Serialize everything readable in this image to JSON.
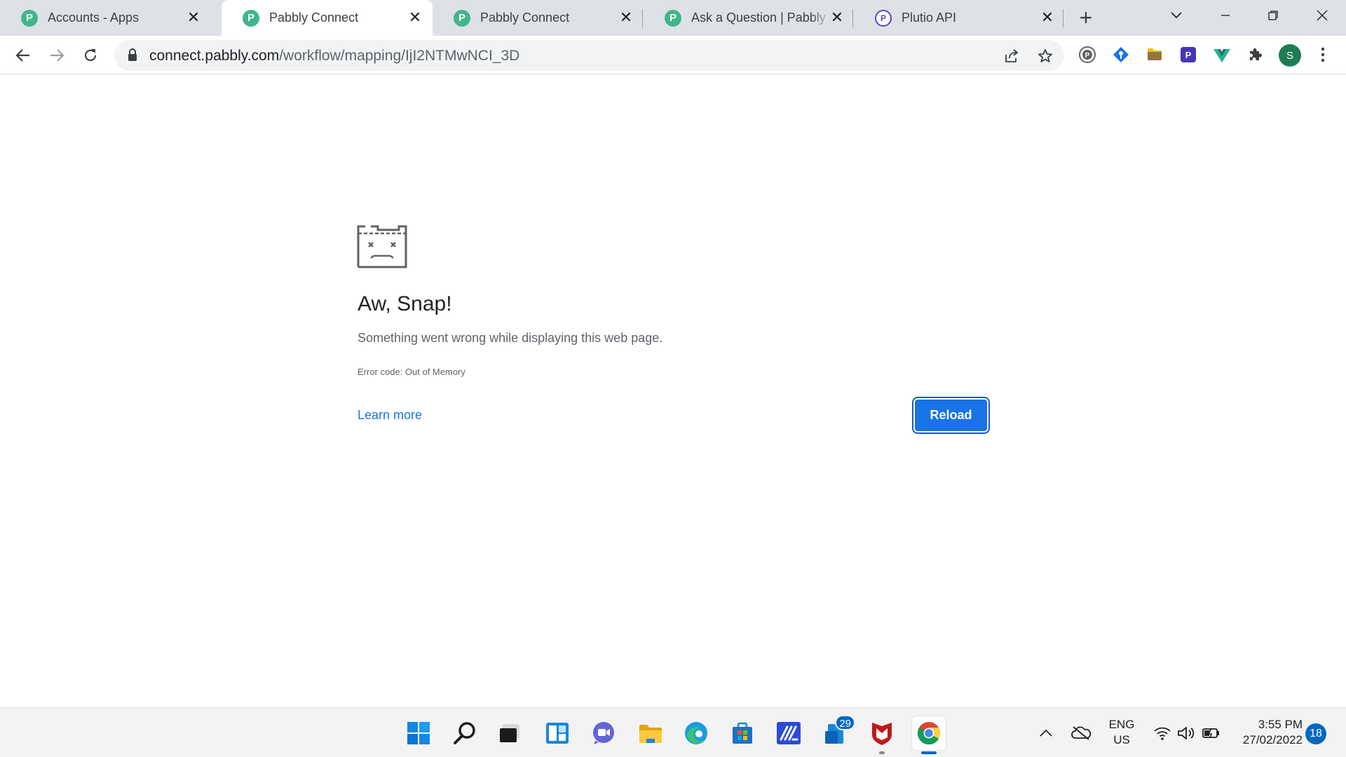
{
  "tabs": [
    {
      "title": "Accounts - Apps",
      "favicon": "pabbly-icon",
      "active": false
    },
    {
      "title": "Pabbly Connect",
      "favicon": "pabbly-icon",
      "active": true
    },
    {
      "title": "Pabbly Connect",
      "favicon": "pabbly-icon",
      "active": false
    },
    {
      "title": "Ask a Question | Pabbly S",
      "favicon": "pabbly-icon",
      "active": false
    },
    {
      "title": "Plutio API",
      "favicon": "plutio-icon",
      "active": false
    }
  ],
  "address_bar": {
    "host": "connect.pabbly.com",
    "path": "/workflow/mapping/IjI2NTMwNCI_3D"
  },
  "profile": {
    "initial": "S"
  },
  "error_page": {
    "title": "Aw, Snap!",
    "description": "Something went wrong while displaying this web page.",
    "error_code": "Error code: Out of Memory",
    "learn_more": "Learn more",
    "reload": "Reload"
  },
  "taskbar": {
    "mail_badge": "29",
    "language_line1": "ENG",
    "language_line2": "US",
    "time": "3:55 PM",
    "date": "27/02/2022",
    "notification_count": "18"
  },
  "colors": {
    "accent": "#1a73e8",
    "pabbly": "#3fb68b",
    "plutio": "#5b46c8",
    "taskbar_badge": "#0067c0"
  }
}
